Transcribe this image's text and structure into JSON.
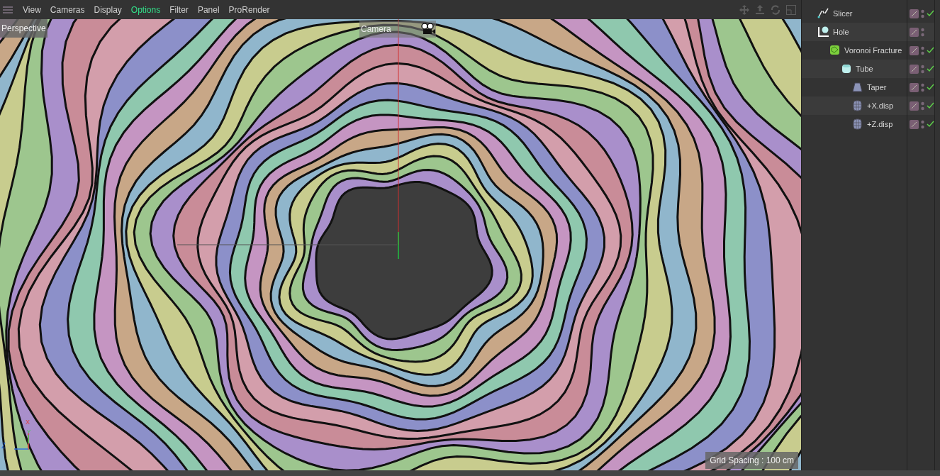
{
  "menu": [
    {
      "label": "View",
      "selected": false
    },
    {
      "label": "Cameras",
      "selected": false
    },
    {
      "label": "Display",
      "selected": false
    },
    {
      "label": "Options",
      "selected": true
    },
    {
      "label": "Filter",
      "selected": false
    },
    {
      "label": "Panel",
      "selected": false
    },
    {
      "label": "ProRender",
      "selected": false
    }
  ],
  "viewport": {
    "view_name": "Perspective",
    "camera_label": "Camera",
    "grid_spacing": "Grid Spacing : 100 cm",
    "axes": [
      "X",
      "Y",
      "Z"
    ]
  },
  "objects": [
    {
      "name": "Slicer",
      "kind": "slicer",
      "enabled": true
    },
    {
      "name": "Hole",
      "kind": "hole",
      "enabled": false,
      "children": [
        {
          "name": "Voronoi Fracture",
          "kind": "fracture",
          "enabled": true,
          "children": [
            {
              "name": "Tube",
              "kind": "tube",
              "enabled": true,
              "children": [
                {
                  "name": "Taper",
                  "kind": "taper",
                  "enabled": true
                },
                {
                  "name": "+X.disp",
                  "kind": "displacer",
                  "enabled": true
                },
                {
                  "name": "+Z.disp",
                  "kind": "displacer",
                  "enabled": true
                }
              ]
            }
          ]
        }
      ]
    }
  ]
}
